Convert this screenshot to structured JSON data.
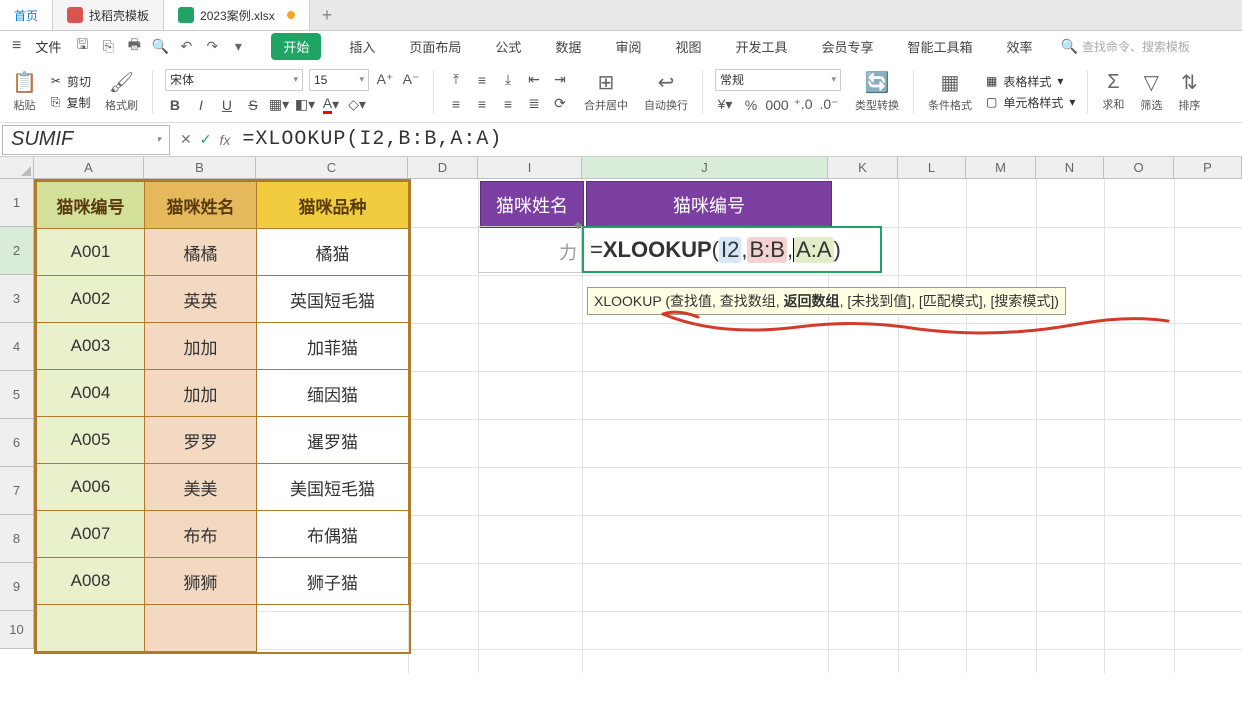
{
  "tabs": {
    "home": "首页",
    "tpl": "找稻壳模板",
    "file": "2023案例.xlsx"
  },
  "menu": {
    "file": "文件",
    "items": [
      "开始",
      "插入",
      "页面布局",
      "公式",
      "数据",
      "审阅",
      "视图",
      "开发工具",
      "会员专享",
      "智能工具箱",
      "效率"
    ],
    "search_ph": "查找命令、搜索模板"
  },
  "ribbon": {
    "paste": "粘贴",
    "cut": "剪切",
    "copy": "复制",
    "fmtpaint": "格式刷",
    "font_name": "宋体",
    "font_size": "15",
    "merge": "合并居中",
    "wrap": "自动换行",
    "general": "常规",
    "type_convert": "类型转换",
    "cond_fmt": "条件格式",
    "table_style": "表格样式",
    "cell_style": "单元格样式",
    "sum": "求和",
    "filter": "筛选",
    "sort": "排序"
  },
  "fx": {
    "name_box": "SUMIF",
    "formula": "=XLOOKUP(I2,B:B,A:A)",
    "tip_fn": "XLOOKUP",
    "tip_pre": " (查找值, 查找数组, ",
    "tip_bold": "返回数组",
    "tip_post": ", [未找到值], [匹配模式], [搜索模式])"
  },
  "cols": [
    "A",
    "B",
    "C",
    "D",
    "I",
    "J",
    "K",
    "L",
    "M",
    "N",
    "O",
    "P"
  ],
  "colw": {
    "A": 110,
    "B": 112,
    "C": 152,
    "D": 70,
    "I": 104,
    "J": 246,
    "K": 70,
    "L": 68,
    "M": 70,
    "N": 68,
    "O": 70,
    "P": 68
  },
  "t1": {
    "h": [
      "猫咪编号",
      "猫咪姓名",
      "猫咪品种"
    ],
    "rows": [
      [
        "A001",
        "橘橘",
        "橘猫"
      ],
      [
        "A002",
        "英英",
        "英国短毛猫"
      ],
      [
        "A003",
        "加加",
        "加菲猫"
      ],
      [
        "A004",
        "加加",
        "缅因猫"
      ],
      [
        "A005",
        "罗罗",
        "暹罗猫"
      ],
      [
        "A006",
        "美美",
        "美国短毛猫"
      ],
      [
        "A007",
        "布布",
        "布偶猫"
      ],
      [
        "A008",
        "狮狮",
        "狮子猫"
      ]
    ]
  },
  "t2": {
    "h": [
      "猫咪姓名",
      "猫咪编号"
    ]
  },
  "edit": {
    "eq": "=",
    "fn": "XLOOKUP",
    "open": "(",
    "p1": "I2",
    "c1": ",",
    "p2": "B:B",
    "c2": ",",
    "p3": "A:A",
    "close": ")"
  },
  "i2_hint": "力",
  "chart_data": {
    "type": "table",
    "tables": [
      {
        "name": "cats",
        "columns": [
          "猫咪编号",
          "猫咪姓名",
          "猫咪品种"
        ],
        "rows": [
          [
            "A001",
            "橘橘",
            "橘猫"
          ],
          [
            "A002",
            "英英",
            "英国短毛猫"
          ],
          [
            "A003",
            "加加",
            "加菲猫"
          ],
          [
            "A004",
            "加加",
            "缅因猫"
          ],
          [
            "A005",
            "罗罗",
            "暹罗猫"
          ],
          [
            "A006",
            "美美",
            "美国短毛猫"
          ],
          [
            "A007",
            "布布",
            "布偶猫"
          ],
          [
            "A008",
            "狮狮",
            "狮子猫"
          ]
        ]
      },
      {
        "name": "lookup",
        "columns": [
          "猫咪姓名",
          "猫咪编号"
        ],
        "rows": [
          [
            "",
            "=XLOOKUP(I2,B:B,A:A)"
          ]
        ]
      }
    ]
  }
}
